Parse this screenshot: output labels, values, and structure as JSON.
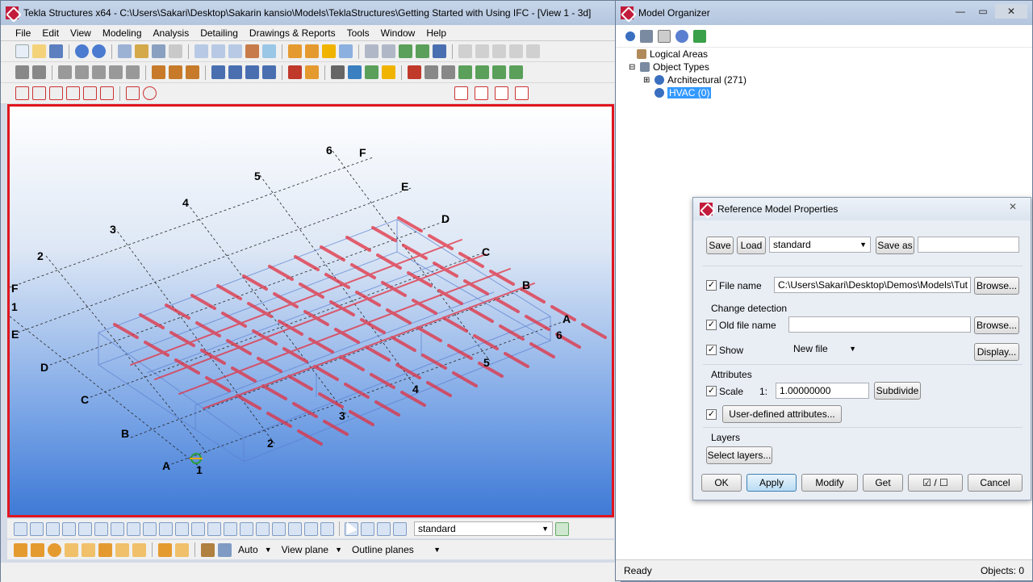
{
  "main_window": {
    "title": "Tekla Structures x64 - C:\\Users\\Sakari\\Desktop\\Sakarin kansio\\Models\\TeklaStructures\\Getting Started with Using IFC  - [View 1 - 3d]",
    "menu": [
      "File",
      "Edit",
      "View",
      "Modeling",
      "Analysis",
      "Detailing",
      "Drawings & Reports",
      "Tools",
      "Window",
      "Help"
    ],
    "grid_labels": {
      "numbers_top": [
        "2",
        "3",
        "4",
        "5",
        "6"
      ],
      "letters_top": [
        "F",
        "E",
        "D",
        "C",
        "B",
        "A"
      ],
      "numbers_bottom": [
        "1",
        "2",
        "3",
        "4",
        "5",
        "6"
      ],
      "letters_left": [
        "F",
        "1",
        "E",
        "D",
        "C",
        "B",
        "A"
      ]
    },
    "bottom_combo": "standard",
    "snap_combo_1": "Auto",
    "snap_combo_2": "View plane",
    "snap_combo_3": "Outline planes"
  },
  "organizer": {
    "title": "Model Organizer",
    "tree": {
      "logical_areas": "Logical Areas",
      "object_types": "Object Types",
      "architectural": "Architectural (271)",
      "hvac": "HVAC (0)"
    },
    "status_left": "Ready",
    "status_right": "Objects: 0"
  },
  "dialog": {
    "title": "Reference Model Properties",
    "save_label": "Save",
    "load_label": "Load",
    "preset_value": "standard",
    "save_as_label": "Save as",
    "save_as_value": "",
    "file_name_label": "File name",
    "file_name_value": "C:\\Users\\Sakari\\Desktop\\Demos\\Models\\Tut",
    "browse_label": "Browse...",
    "change_detection_label": "Change detection",
    "old_file_label": "Old file name",
    "old_file_value": "",
    "show_label": "Show",
    "show_value": "New file",
    "display_label": "Display...",
    "attributes_label": "Attributes",
    "scale_label": "Scale",
    "scale_prefix": "1:",
    "scale_value": "1.00000000",
    "subdivide_label": "Subdivide",
    "uda_label": "User-defined attributes...",
    "layers_label": "Layers",
    "select_layers_label": "Select layers...",
    "ok_label": "OK",
    "apply_label": "Apply",
    "modify_label": "Modify",
    "get_label": "Get",
    "toggle_label": "☑ / ☐",
    "cancel_label": "Cancel"
  },
  "colors": {
    "accent_red": "#e0151f",
    "selection": "#3399ff"
  }
}
